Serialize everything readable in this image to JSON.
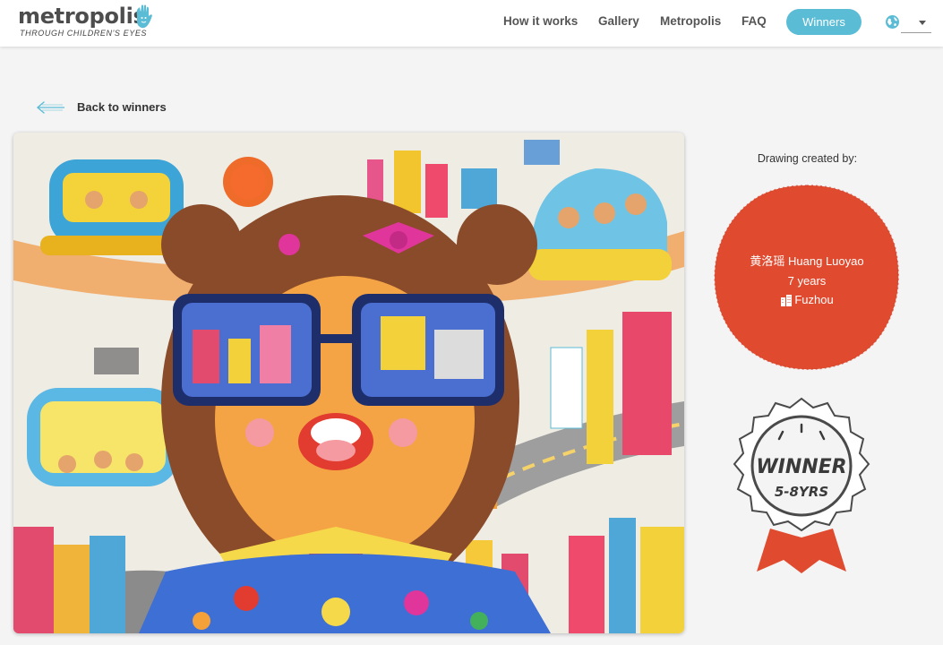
{
  "logo": {
    "wordmark": "metropolis",
    "tagline": "THROUGH CHILDREN'S EYES"
  },
  "nav": {
    "links": [
      "How it works",
      "Gallery",
      "Metropolis",
      "FAQ"
    ],
    "cta_label": "Winners",
    "language_value": ""
  },
  "back": {
    "label": "Back to winners"
  },
  "artist": {
    "created_by_label": "Drawing created by:",
    "name": "黄洛瑶 Huang Luoyao",
    "age": "7 years",
    "city": "Fuzhou"
  },
  "badge": {
    "line1": "WINNER",
    "line2": "5-8YRS"
  },
  "colors": {
    "accent": "#5bbcd6",
    "artist_circle": "#e04a2f",
    "background": "#f4f4f4"
  }
}
